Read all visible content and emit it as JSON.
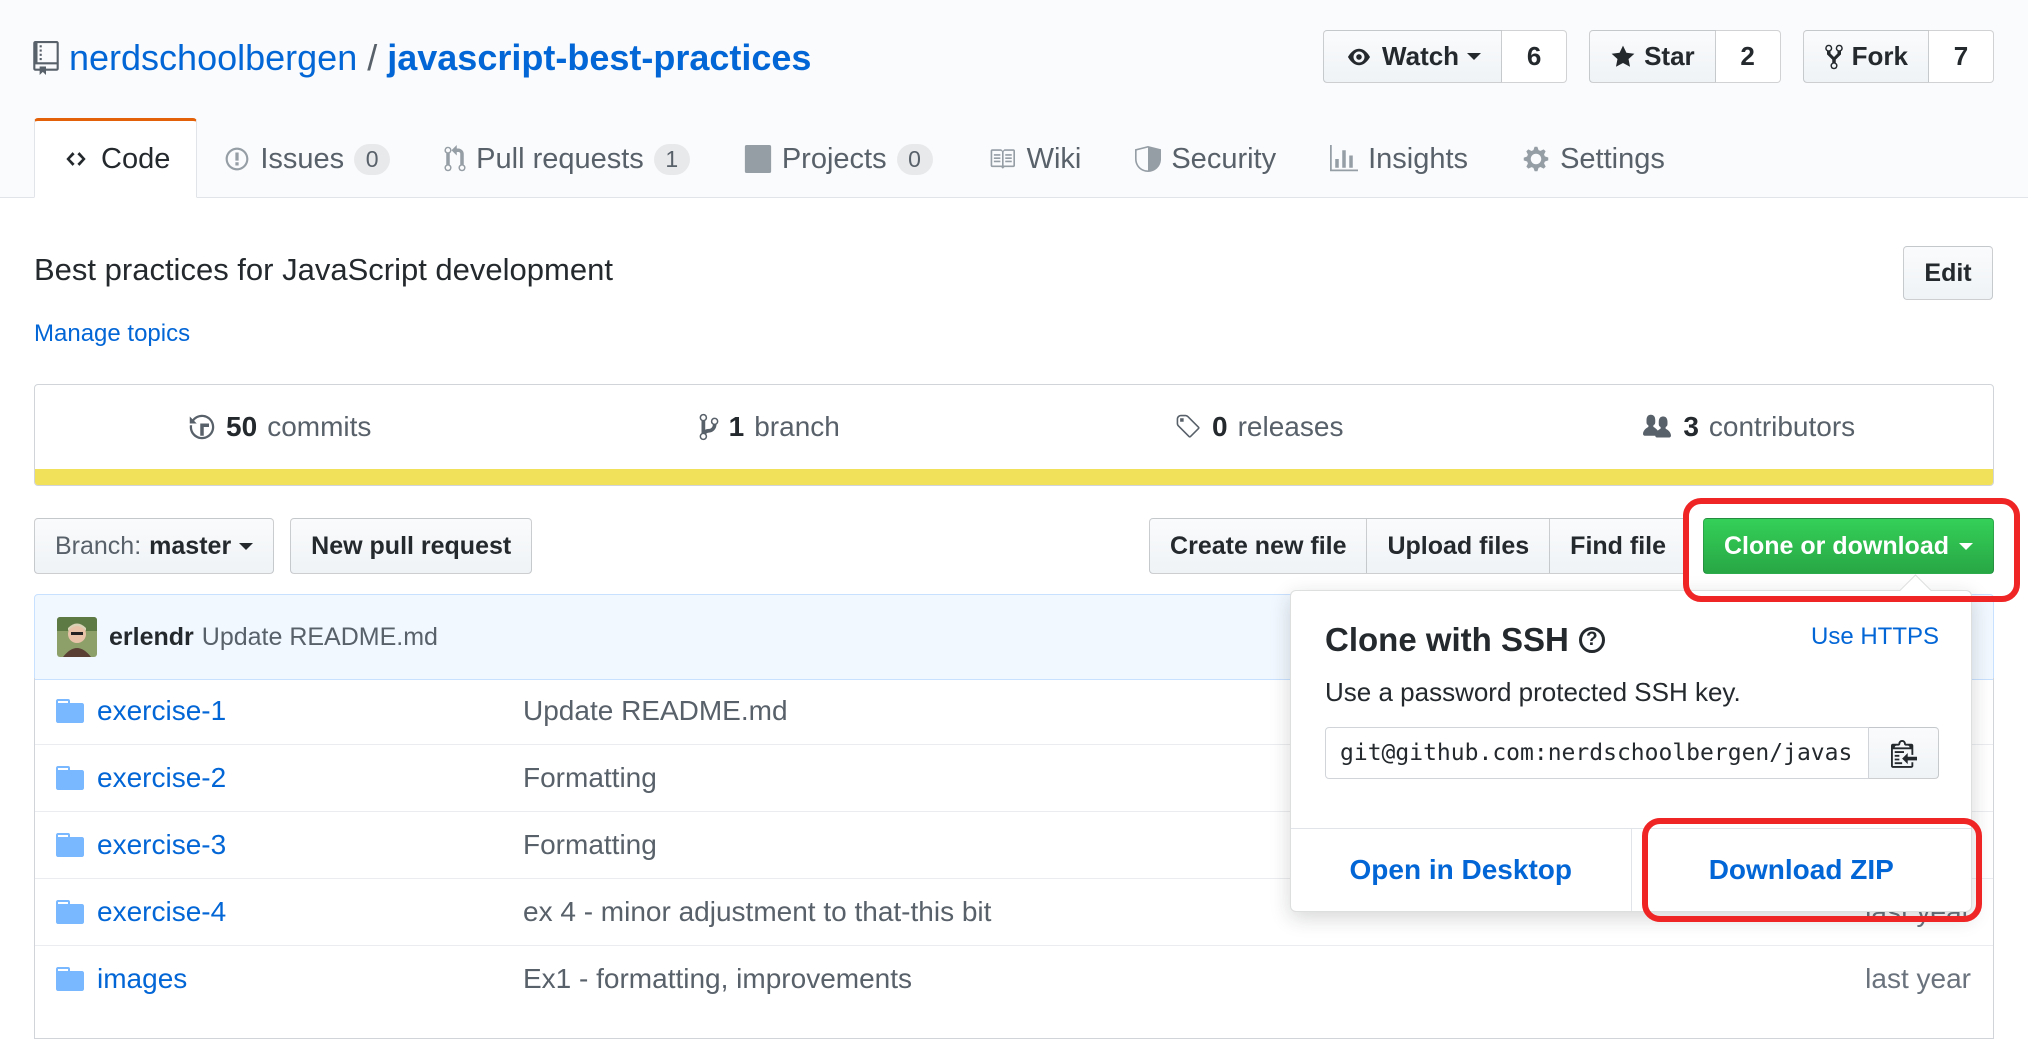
{
  "repo": {
    "owner": "nerdschoolbergen",
    "separator": "/",
    "name": "javascript-best-practices"
  },
  "actions": {
    "watch": {
      "label": "Watch",
      "count": "6"
    },
    "star": {
      "label": "Star",
      "count": "2"
    },
    "fork": {
      "label": "Fork",
      "count": "7"
    }
  },
  "nav": {
    "code": "Code",
    "issues": {
      "label": "Issues",
      "count": "0"
    },
    "pulls": {
      "label": "Pull requests",
      "count": "1"
    },
    "projects": {
      "label": "Projects",
      "count": "0"
    },
    "wiki": "Wiki",
    "security": "Security",
    "insights": "Insights",
    "settings": "Settings"
  },
  "description": "Best practices for JavaScript development",
  "manage_topics": "Manage topics",
  "edit_label": "Edit",
  "summary": {
    "commits": {
      "count": "50",
      "label": "commits"
    },
    "branches": {
      "count": "1",
      "label": "branch"
    },
    "releases": {
      "count": "0",
      "label": "releases"
    },
    "contributors": {
      "count": "3",
      "label": "contributors"
    },
    "language_color": "#f1e05a"
  },
  "toolbar": {
    "branch_prefix": "Branch:",
    "branch_name": "master",
    "new_pull_request": "New pull request",
    "create_new_file": "Create new file",
    "upload_files": "Upload files",
    "find_file": "Find file",
    "clone_or_download": "Clone or download"
  },
  "latest_commit": {
    "author": "erlendr",
    "message": "Update README.md"
  },
  "files": [
    {
      "name": "exercise-1",
      "message": "Update README.md",
      "age": ""
    },
    {
      "name": "exercise-2",
      "message": "Formatting",
      "age": ""
    },
    {
      "name": "exercise-3",
      "message": "Formatting",
      "age": ""
    },
    {
      "name": "exercise-4",
      "message": "ex 4 - minor adjustment to that-this bit",
      "age": "last year"
    },
    {
      "name": "images",
      "message": "Ex1 - formatting, improvements",
      "age": "last year"
    }
  ],
  "clone_panel": {
    "title": "Clone with SSH",
    "use_https": "Use HTTPS",
    "subtitle": "Use a password protected SSH key.",
    "url": "git@github.com:nerdschoolbergen/javascript-best-practices.git",
    "open_in_desktop": "Open in Desktop",
    "download_zip": "Download ZIP"
  },
  "colors": {
    "link": "#0366d6",
    "primary_button": "#2ea44f",
    "highlight": "#ef2424",
    "tab_accent": "#e36209"
  }
}
